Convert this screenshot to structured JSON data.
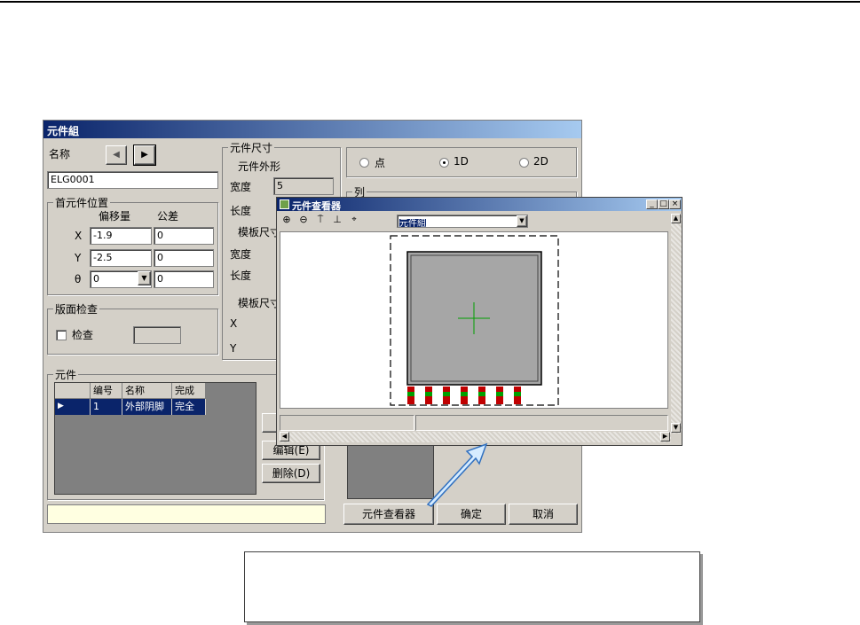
{
  "dialog": {
    "title": "元件組",
    "name_label": "名称",
    "name_value": "ELG0001",
    "first_pos": {
      "group_title": "首元件位置",
      "col_offset": "偏移量",
      "col_tolerance": "公差",
      "rows": [
        {
          "axis": "X",
          "offset": "-1.9",
          "tol": "0"
        },
        {
          "axis": "Y",
          "offset": "-2.5",
          "tol": "0"
        },
        {
          "axis": "θ",
          "offset": "0",
          "tol": "0"
        }
      ]
    },
    "board_check": {
      "group_title": "版面检查",
      "checkbox_label": "检查"
    },
    "size": {
      "group_title": "元件尺寸",
      "outline_label": "元件外形",
      "width_label": "宽度",
      "width_value": "5",
      "length_label": "长度",
      "template_label": "模板尺寸",
      "template_width_label": "宽度",
      "template_length_label": "长度",
      "template2_label": "模板尺寸",
      "x_label": "X",
      "y_label": "Y"
    },
    "mode": {
      "point": "点",
      "one_d": "1D",
      "two_d": "2D",
      "selected": "1D"
    },
    "array_group_title": "列",
    "parts": {
      "group_title": "元件",
      "columns": [
        "",
        "编号",
        "名称",
        "完成"
      ],
      "rows": [
        {
          "num": "1",
          "name": "外部阴脚",
          "done": "完全"
        }
      ]
    },
    "edit_button": "编辑(E)",
    "delete_button": "删除(D)",
    "viewer_button": "元件查看器",
    "ok_button": "确定",
    "cancel_button": "取消"
  },
  "viewer": {
    "title": "元件查看器",
    "dropdown_value": "元件組",
    "tools": [
      "zoom-in-icon",
      "zoom-out-icon",
      "filter-icon",
      "anchor-icon",
      "zoom-fit-icon"
    ],
    "colors": {
      "pad_red": "#c00000",
      "pad_green": "#00a000",
      "body": "#a6a6a6",
      "crosshair": "#00a000"
    }
  }
}
